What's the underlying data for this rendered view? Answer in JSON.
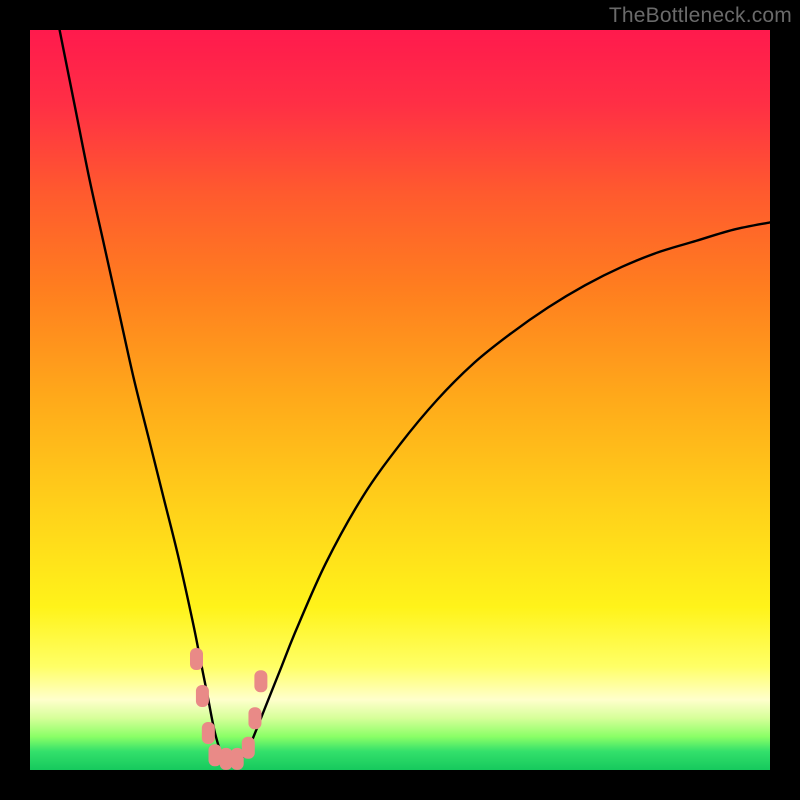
{
  "watermark": "TheBottleneck.com",
  "gradient": {
    "stops": [
      {
        "offset": 0.0,
        "color": "#ff1a4d"
      },
      {
        "offset": 0.1,
        "color": "#ff2f45"
      },
      {
        "offset": 0.22,
        "color": "#ff5a2e"
      },
      {
        "offset": 0.35,
        "color": "#ff7e1f"
      },
      {
        "offset": 0.5,
        "color": "#ffaa1a"
      },
      {
        "offset": 0.65,
        "color": "#ffd21a"
      },
      {
        "offset": 0.78,
        "color": "#fff31a"
      },
      {
        "offset": 0.86,
        "color": "#ffff66"
      },
      {
        "offset": 0.905,
        "color": "#ffffcc"
      },
      {
        "offset": 0.93,
        "color": "#d6ff99"
      },
      {
        "offset": 0.955,
        "color": "#8aff66"
      },
      {
        "offset": 0.975,
        "color": "#33e06b"
      },
      {
        "offset": 1.0,
        "color": "#16c95d"
      }
    ]
  },
  "chart_data": {
    "type": "line",
    "title": "",
    "xlabel": "",
    "ylabel": "",
    "xlim": [
      0,
      100
    ],
    "ylim": [
      0,
      100
    ],
    "series": [
      {
        "name": "bottleneck-curve",
        "x": [
          4,
          6,
          8,
          10,
          12,
          14,
          16,
          18,
          20,
          22,
          23,
          24,
          25,
          26,
          27,
          28,
          29,
          30,
          32,
          34,
          36,
          40,
          45,
          50,
          55,
          60,
          65,
          70,
          75,
          80,
          85,
          90,
          95,
          100
        ],
        "y": [
          100,
          90,
          80,
          71,
          62,
          53,
          45,
          37,
          29,
          20,
          15,
          10,
          5,
          2,
          1.5,
          1.5,
          2,
          4,
          9,
          14,
          19,
          28,
          37,
          44,
          50,
          55,
          59,
          62.5,
          65.5,
          68,
          70,
          71.5,
          73,
          74
        ]
      }
    ],
    "markers": {
      "name": "highlight-cluster",
      "color": "#e98a87",
      "points": [
        {
          "x": 22.5,
          "y": 15
        },
        {
          "x": 23.3,
          "y": 10
        },
        {
          "x": 24.1,
          "y": 5
        },
        {
          "x": 25.0,
          "y": 2
        },
        {
          "x": 26.5,
          "y": 1.5
        },
        {
          "x": 28.0,
          "y": 1.5
        },
        {
          "x": 29.5,
          "y": 3
        },
        {
          "x": 30.4,
          "y": 7
        },
        {
          "x": 31.2,
          "y": 12
        }
      ]
    }
  }
}
